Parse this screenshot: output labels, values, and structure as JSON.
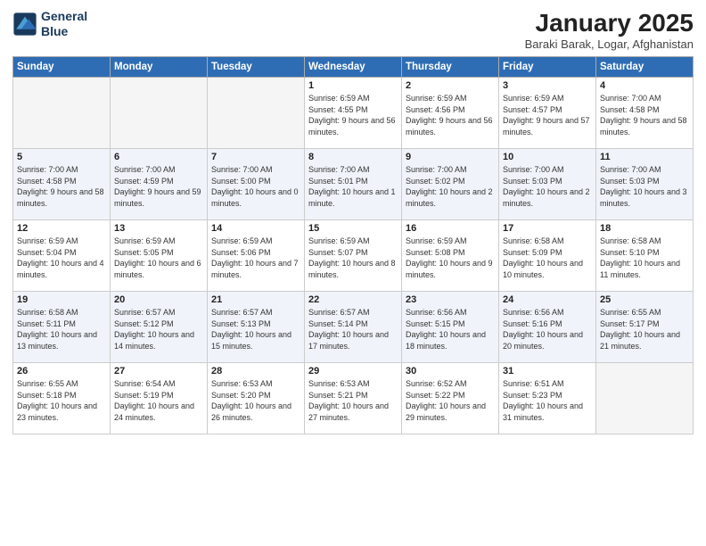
{
  "logo": {
    "line1": "General",
    "line2": "Blue"
  },
  "title": "January 2025",
  "subtitle": "Baraki Barak, Logar, Afghanistan",
  "days_of_week": [
    "Sunday",
    "Monday",
    "Tuesday",
    "Wednesday",
    "Thursday",
    "Friday",
    "Saturday"
  ],
  "weeks": [
    [
      {
        "day": "",
        "info": ""
      },
      {
        "day": "",
        "info": ""
      },
      {
        "day": "",
        "info": ""
      },
      {
        "day": "1",
        "info": "Sunrise: 6:59 AM\nSunset: 4:55 PM\nDaylight: 9 hours and 56 minutes."
      },
      {
        "day": "2",
        "info": "Sunrise: 6:59 AM\nSunset: 4:56 PM\nDaylight: 9 hours and 56 minutes."
      },
      {
        "day": "3",
        "info": "Sunrise: 6:59 AM\nSunset: 4:57 PM\nDaylight: 9 hours and 57 minutes."
      },
      {
        "day": "4",
        "info": "Sunrise: 7:00 AM\nSunset: 4:58 PM\nDaylight: 9 hours and 58 minutes."
      }
    ],
    [
      {
        "day": "5",
        "info": "Sunrise: 7:00 AM\nSunset: 4:58 PM\nDaylight: 9 hours and 58 minutes."
      },
      {
        "day": "6",
        "info": "Sunrise: 7:00 AM\nSunset: 4:59 PM\nDaylight: 9 hours and 59 minutes."
      },
      {
        "day": "7",
        "info": "Sunrise: 7:00 AM\nSunset: 5:00 PM\nDaylight: 10 hours and 0 minutes."
      },
      {
        "day": "8",
        "info": "Sunrise: 7:00 AM\nSunset: 5:01 PM\nDaylight: 10 hours and 1 minute."
      },
      {
        "day": "9",
        "info": "Sunrise: 7:00 AM\nSunset: 5:02 PM\nDaylight: 10 hours and 2 minutes."
      },
      {
        "day": "10",
        "info": "Sunrise: 7:00 AM\nSunset: 5:03 PM\nDaylight: 10 hours and 2 minutes."
      },
      {
        "day": "11",
        "info": "Sunrise: 7:00 AM\nSunset: 5:03 PM\nDaylight: 10 hours and 3 minutes."
      }
    ],
    [
      {
        "day": "12",
        "info": "Sunrise: 6:59 AM\nSunset: 5:04 PM\nDaylight: 10 hours and 4 minutes."
      },
      {
        "day": "13",
        "info": "Sunrise: 6:59 AM\nSunset: 5:05 PM\nDaylight: 10 hours and 6 minutes."
      },
      {
        "day": "14",
        "info": "Sunrise: 6:59 AM\nSunset: 5:06 PM\nDaylight: 10 hours and 7 minutes."
      },
      {
        "day": "15",
        "info": "Sunrise: 6:59 AM\nSunset: 5:07 PM\nDaylight: 10 hours and 8 minutes."
      },
      {
        "day": "16",
        "info": "Sunrise: 6:59 AM\nSunset: 5:08 PM\nDaylight: 10 hours and 9 minutes."
      },
      {
        "day": "17",
        "info": "Sunrise: 6:58 AM\nSunset: 5:09 PM\nDaylight: 10 hours and 10 minutes."
      },
      {
        "day": "18",
        "info": "Sunrise: 6:58 AM\nSunset: 5:10 PM\nDaylight: 10 hours and 11 minutes."
      }
    ],
    [
      {
        "day": "19",
        "info": "Sunrise: 6:58 AM\nSunset: 5:11 PM\nDaylight: 10 hours and 13 minutes."
      },
      {
        "day": "20",
        "info": "Sunrise: 6:57 AM\nSunset: 5:12 PM\nDaylight: 10 hours and 14 minutes."
      },
      {
        "day": "21",
        "info": "Sunrise: 6:57 AM\nSunset: 5:13 PM\nDaylight: 10 hours and 15 minutes."
      },
      {
        "day": "22",
        "info": "Sunrise: 6:57 AM\nSunset: 5:14 PM\nDaylight: 10 hours and 17 minutes."
      },
      {
        "day": "23",
        "info": "Sunrise: 6:56 AM\nSunset: 5:15 PM\nDaylight: 10 hours and 18 minutes."
      },
      {
        "day": "24",
        "info": "Sunrise: 6:56 AM\nSunset: 5:16 PM\nDaylight: 10 hours and 20 minutes."
      },
      {
        "day": "25",
        "info": "Sunrise: 6:55 AM\nSunset: 5:17 PM\nDaylight: 10 hours and 21 minutes."
      }
    ],
    [
      {
        "day": "26",
        "info": "Sunrise: 6:55 AM\nSunset: 5:18 PM\nDaylight: 10 hours and 23 minutes."
      },
      {
        "day": "27",
        "info": "Sunrise: 6:54 AM\nSunset: 5:19 PM\nDaylight: 10 hours and 24 minutes."
      },
      {
        "day": "28",
        "info": "Sunrise: 6:53 AM\nSunset: 5:20 PM\nDaylight: 10 hours and 26 minutes."
      },
      {
        "day": "29",
        "info": "Sunrise: 6:53 AM\nSunset: 5:21 PM\nDaylight: 10 hours and 27 minutes."
      },
      {
        "day": "30",
        "info": "Sunrise: 6:52 AM\nSunset: 5:22 PM\nDaylight: 10 hours and 29 minutes."
      },
      {
        "day": "31",
        "info": "Sunrise: 6:51 AM\nSunset: 5:23 PM\nDaylight: 10 hours and 31 minutes."
      },
      {
        "day": "",
        "info": ""
      }
    ]
  ]
}
